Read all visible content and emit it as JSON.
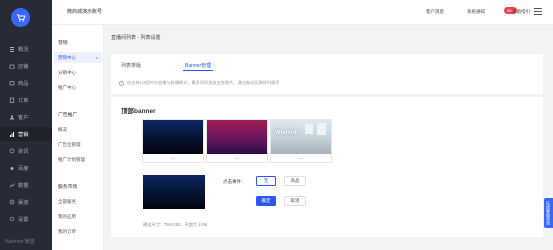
{
  "topbar": {
    "store_name": "微商城演示账号",
    "links": [
      "客户消息",
      "系统通知",
      "帮助指引"
    ],
    "notify_badge": "99+"
  },
  "nav": {
    "items": [
      {
        "label": "概况",
        "icon": "overview-icon"
      },
      {
        "label": "店铺",
        "icon": "store-icon"
      },
      {
        "label": "商品",
        "icon": "goods-icon"
      },
      {
        "label": "订单",
        "icon": "order-icon"
      },
      {
        "label": "客户",
        "icon": "customer-icon"
      },
      {
        "label": "营销",
        "icon": "marketing-icon"
      },
      {
        "label": "资讯",
        "icon": "news-icon"
      },
      {
        "label": "百度",
        "icon": "baidu-icon"
      },
      {
        "label": "数据",
        "icon": "data-icon"
      },
      {
        "label": "渠道",
        "icon": "channel-icon"
      },
      {
        "label": "设置",
        "icon": "settings-icon"
      }
    ],
    "active_index": 5,
    "footer": "Weimob 微盟"
  },
  "sub": {
    "head1": "营销",
    "items1": [
      "营销中心",
      "分销中心",
      "推广中心"
    ],
    "head2": "广告推广",
    "items2": [
      "概况",
      "广告位管理",
      "推广计划管理"
    ],
    "head3": "服务市场",
    "items3": [
      "全部服务",
      "我的应用",
      "我的订单"
    ],
    "active": "营销中心"
  },
  "breadcrumb": "直播间列表 · 列表设置",
  "tabs": [
    "列表排版",
    "Banner管理"
  ],
  "active_tab": "Banner管理",
  "tip": "仅支持1:2图片在轮播与轮播模式，最多同时投放五张图片，通过拖动切换排列顺序",
  "banner": {
    "title": "顶部banner",
    "thumb_caption": "...",
    "watermark": "Weimob",
    "action_label": "点击事件：",
    "option_none": "无",
    "option_product": "商品",
    "confirm": "确定",
    "cancel": "取消",
    "hint": "建议尺寸：750×250，不超大于2M"
  },
  "float_help": "在线客服咨询"
}
